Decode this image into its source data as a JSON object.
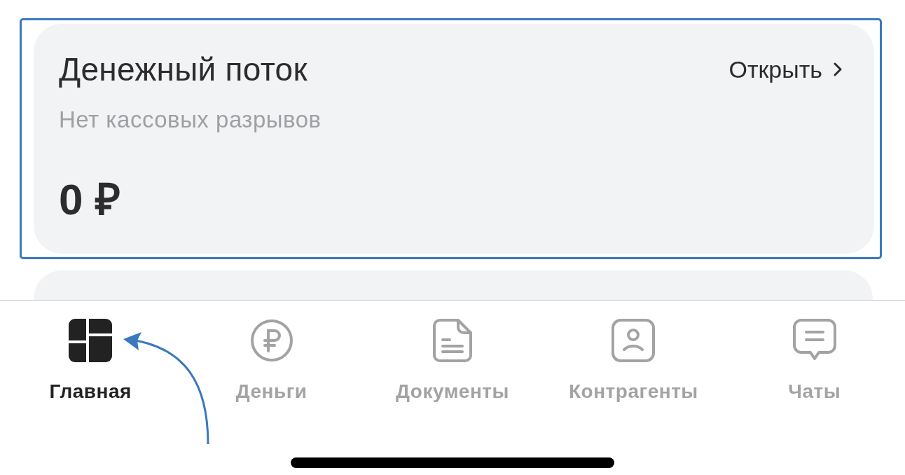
{
  "card": {
    "title": "Денежный поток",
    "subtitle": "Нет кассовых разрывов",
    "amount": "0 ₽",
    "action": "Открыть"
  },
  "tabs": [
    {
      "label": "Главная",
      "selected": true
    },
    {
      "label": "Деньги",
      "selected": false
    },
    {
      "label": "Документы",
      "selected": false
    },
    {
      "label": "Контрагенты",
      "selected": false
    },
    {
      "label": "Чаты",
      "selected": false
    }
  ]
}
